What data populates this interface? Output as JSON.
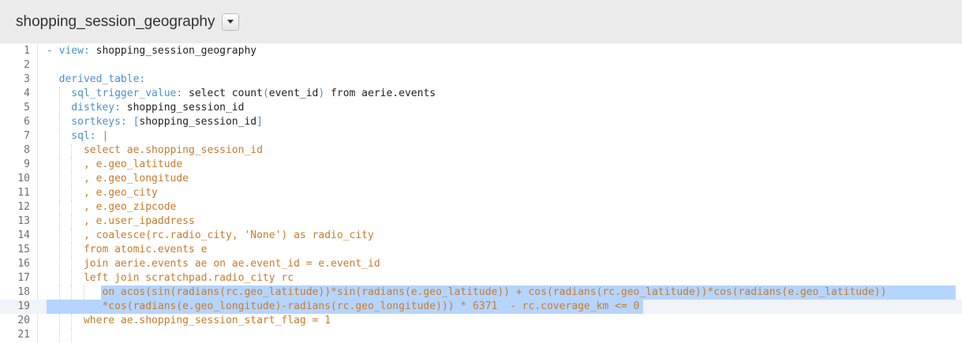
{
  "header": {
    "title": "shopping_session_geography"
  },
  "editor": {
    "lines": [
      {
        "n": "1",
        "parts": [
          {
            "t": "- view: ",
            "c": "k"
          },
          {
            "t": "shopping_session_geography",
            "c": "v"
          }
        ]
      },
      {
        "n": "2",
        "parts": []
      },
      {
        "n": "3",
        "parts": [
          {
            "t": "  derived_table:",
            "c": "k"
          }
        ]
      },
      {
        "n": "4",
        "parts": [
          {
            "t": "    sql_trigger_value: ",
            "c": "k"
          },
          {
            "t": "select count",
            "c": "v"
          },
          {
            "t": "(",
            "c": "k"
          },
          {
            "t": "event_id",
            "c": "v"
          },
          {
            "t": ")",
            "c": "k"
          },
          {
            "t": " from aerie.events",
            "c": "v"
          }
        ]
      },
      {
        "n": "5",
        "parts": [
          {
            "t": "    distkey: ",
            "c": "k"
          },
          {
            "t": "shopping_session_id",
            "c": "v"
          }
        ]
      },
      {
        "n": "6",
        "parts": [
          {
            "t": "    sortkeys: ",
            "c": "k"
          },
          {
            "t": "[",
            "c": "k"
          },
          {
            "t": "shopping_session_id",
            "c": "v"
          },
          {
            "t": "]",
            "c": "k"
          }
        ]
      },
      {
        "n": "7",
        "parts": [
          {
            "t": "    sql: ",
            "c": "k"
          },
          {
            "t": "|",
            "c": "s"
          }
        ]
      },
      {
        "n": "8",
        "parts": [
          {
            "t": "      select ae.shopping_session_id",
            "c": "s"
          }
        ]
      },
      {
        "n": "9",
        "parts": [
          {
            "t": "      , e.geo_latitude",
            "c": "s"
          }
        ]
      },
      {
        "n": "10",
        "parts": [
          {
            "t": "      , e.geo_longitude",
            "c": "s"
          }
        ]
      },
      {
        "n": "11",
        "parts": [
          {
            "t": "      , e.geo_city",
            "c": "s"
          }
        ]
      },
      {
        "n": "12",
        "parts": [
          {
            "t": "      , e.geo_zipcode",
            "c": "s"
          }
        ]
      },
      {
        "n": "13",
        "parts": [
          {
            "t": "      , e.user_ipaddress",
            "c": "s"
          }
        ]
      },
      {
        "n": "14",
        "parts": [
          {
            "t": "      , coalesce(rc.radio_city, 'None') as radio_city",
            "c": "s"
          }
        ]
      },
      {
        "n": "15",
        "parts": [
          {
            "t": "      from atomic.events e",
            "c": "s"
          }
        ]
      },
      {
        "n": "16",
        "parts": [
          {
            "t": "      join aerie.events ae on ae.event_id = e.event_id",
            "c": "s"
          }
        ]
      },
      {
        "n": "17",
        "parts": [
          {
            "t": "      left join scratchpad.radio_city rc",
            "c": "s"
          }
        ]
      },
      {
        "n": "18",
        "parts": [
          {
            "t": "         on acos(sin(radians(rc.geo_latitude))*sin(radians(e.geo_latitude)) + cos(radians(rc.geo_latitude))*cos(radians(e.geo_latitude))",
            "c": "s"
          }
        ]
      },
      {
        "n": "19",
        "parts": [
          {
            "t": "         *cos(radians(e.geo_longitude)-radians(rc.geo_longitude))) * 6371  - rc.coverage_km <= 0",
            "c": "s"
          }
        ]
      },
      {
        "n": "20",
        "parts": [
          {
            "t": "      where ae.shopping_session_start_flag = 1",
            "c": "s"
          }
        ]
      },
      {
        "n": "21",
        "parts": []
      }
    ]
  },
  "colors": {
    "header_bg": "#ebebeb",
    "yaml_key": "#4d8fc9",
    "sql_text": "#c77b2e",
    "selection": "#b5d5ff"
  }
}
